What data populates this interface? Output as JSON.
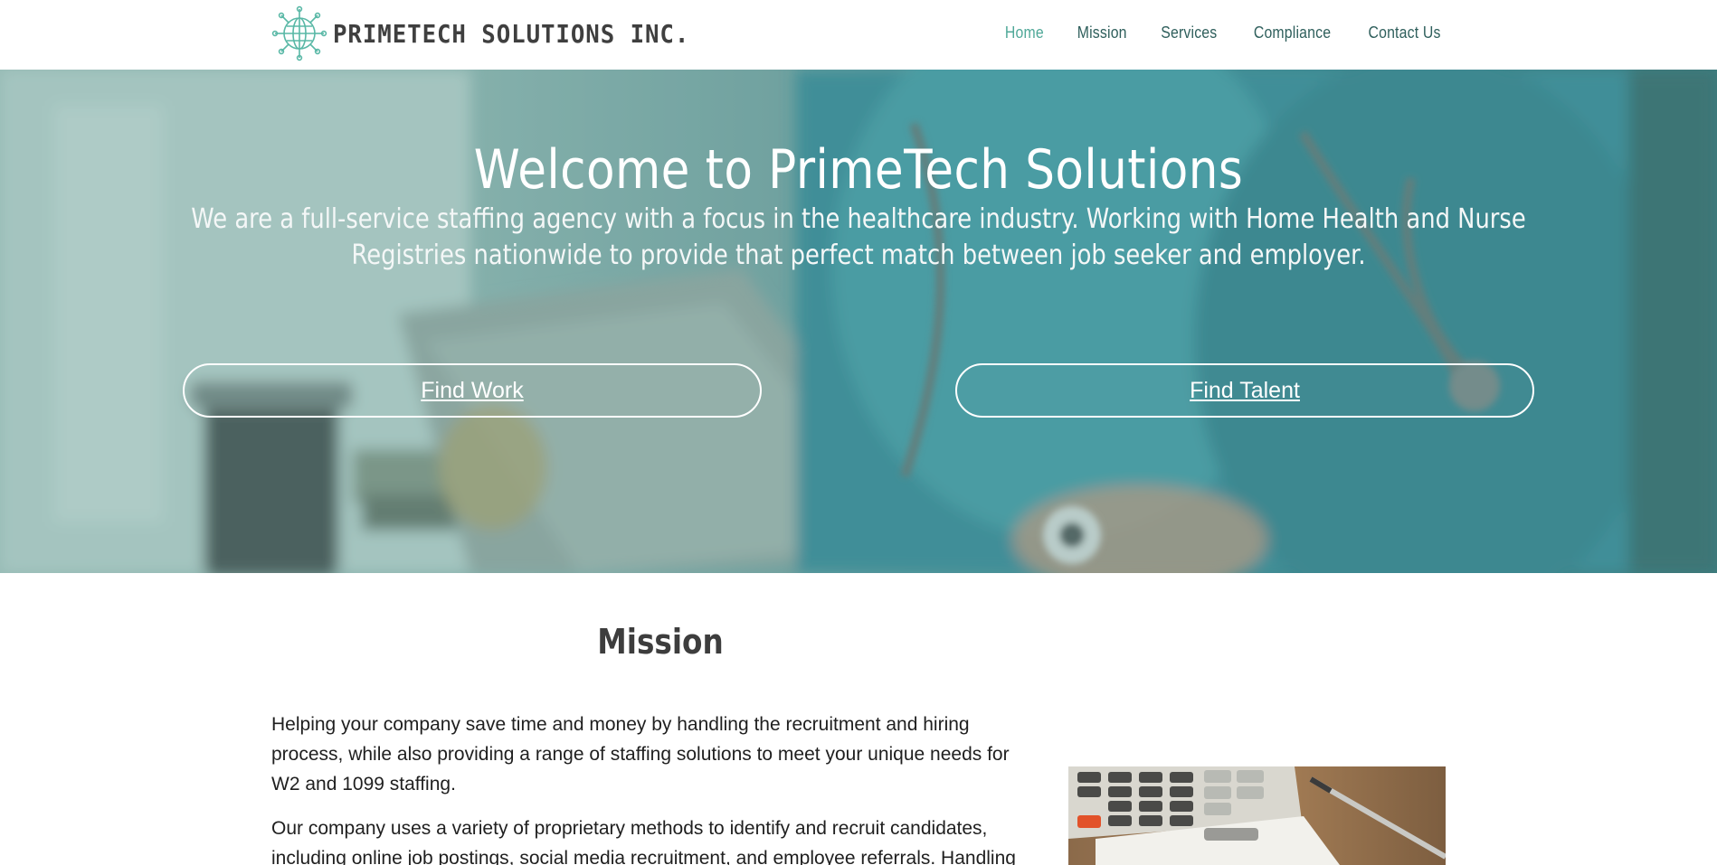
{
  "header": {
    "brand_name": "PRIMETECH SOLUTIONS INC.",
    "logo_icon": "globe-network-icon",
    "nav": [
      {
        "label": "Home",
        "active": true
      },
      {
        "label": "Mission",
        "active": false
      },
      {
        "label": "Services",
        "active": false
      },
      {
        "label": "Compliance",
        "active": false
      },
      {
        "label": "Contact Us",
        "active": false
      }
    ]
  },
  "hero": {
    "title": "Welcome to PrimeTech Solutions",
    "subtitle": "We are a full-service staffing agency with a focus in the healthcare industry. Working with Home Health and Nurse Registries nationwide to provide that perfect match between job seeker and employer.",
    "buttons": {
      "find_work": "Find Work",
      "find_talent": "Find Talent"
    }
  },
  "mission": {
    "title": "Mission",
    "paragraphs": [
      "Helping your company save time and money by handling the recruitment and hiring process, while also providing a range of staffing solutions to meet your unique needs for W2 and 1099 staffing.",
      "Our company uses a variety of proprietary methods to identify and recruit candidates, including online job postings, social media recruitment, and employee referrals. Handling"
    ]
  },
  "colors": {
    "accent": "#4fa898",
    "nav_text": "#2f5f5c",
    "hero_teal": "#2f7f8a",
    "white": "#ffffff"
  }
}
